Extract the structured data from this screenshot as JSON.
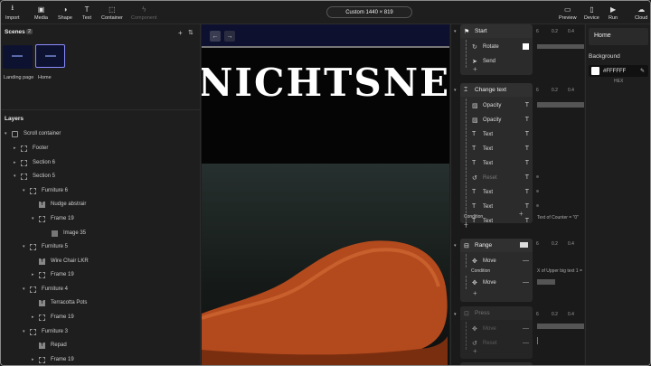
{
  "toolbar": {
    "import": "Import",
    "media": "Media",
    "shape": "Shape",
    "text": "Text",
    "container": "Container",
    "component": "Component",
    "canvas_size": "Custom  1440 × 819",
    "preview": "Preview",
    "device": "Device",
    "run": "Run",
    "cloud": "Cloud"
  },
  "scenes": {
    "title": "Scenes",
    "count": "2",
    "items": [
      {
        "label": "Landing page"
      },
      {
        "label": "Home"
      }
    ]
  },
  "layers": {
    "title": "Layers",
    "items": [
      {
        "label": "Scroll container"
      },
      {
        "label": "Footer"
      },
      {
        "label": "Section 6"
      },
      {
        "label": "Section 5"
      },
      {
        "label": "Furniture 6"
      },
      {
        "label": "Nudge abstrair"
      },
      {
        "label": "Frame 19"
      },
      {
        "label": "Image 35"
      },
      {
        "label": "Furniture 5"
      },
      {
        "label": "Wire Chair LKR"
      },
      {
        "label": "Frame 19"
      },
      {
        "label": "Furniture 4"
      },
      {
        "label": "Terracotta Pots"
      },
      {
        "label": "Frame 19"
      },
      {
        "label": "Furniture 3"
      },
      {
        "label": "Repad"
      },
      {
        "label": "Frame 19"
      }
    ]
  },
  "stage": {
    "big_text": "NICHTSNE"
  },
  "interactions": {
    "start": {
      "label": "Start",
      "rows": [
        "Rotate",
        "Send"
      ]
    },
    "change_text": {
      "label": "Change text",
      "rows": [
        "Opacity",
        "Opacity",
        "Text",
        "Text",
        "Text",
        "Reset",
        "Text",
        "Text",
        "Text"
      ],
      "condition": "Condition",
      "note": "Text of Counter = \"0\""
    },
    "range": {
      "label": "Range",
      "rows": [
        "Move",
        "Move"
      ],
      "condition": "Condition",
      "note": "X of Upper big text 1 ="
    },
    "press": {
      "label": "Press",
      "rows": [
        "Move",
        "Reset"
      ]
    },
    "ticks": [
      "6",
      "0.2",
      "0.4"
    ]
  },
  "right": {
    "title": "Home",
    "background_label": "Background",
    "color_value": "#FFFFFF",
    "color_mode": "HEX",
    "color": "#FFFFFF"
  }
}
